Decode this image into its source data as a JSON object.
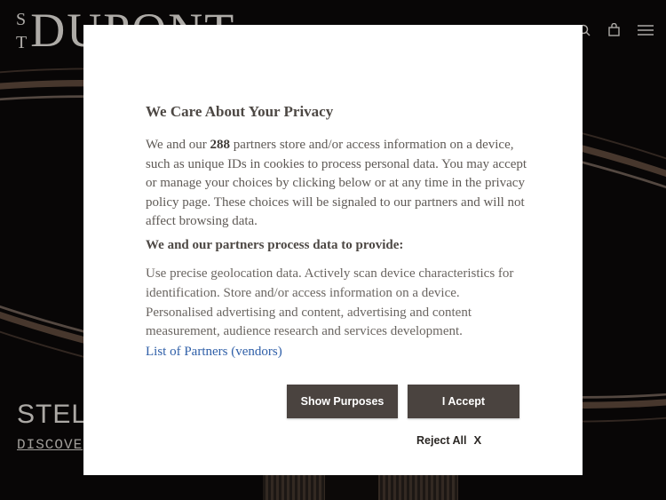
{
  "header": {
    "logo_mono_top": "S",
    "logo_mono_bottom": "T",
    "logo_word": "DUPONT",
    "icons": [
      "search-icon",
      "bag-icon",
      "menu-icon"
    ]
  },
  "hero": {
    "title": "STEL",
    "link": "DISCOVE"
  },
  "consent": {
    "title": "We Care About Your Privacy",
    "body_prefix": "We and our ",
    "partner_count": "288",
    "body_suffix": " partners store and/or access information on a device, such as unique IDs in cookies to process personal data. You may accept or manage your choices by clicking below or at any time in the privacy policy page. These choices will be signaled to our partners and will not affect browsing data.",
    "subtitle": "We and our partners process data to provide:",
    "purposes": "Use precise geolocation data. Actively scan device characteristics for identification. Store and/or access information on a device. Personalised advertising and content, advertising and content measurement, audience research and services development.",
    "partners_link": "List of Partners (vendors)",
    "show_purposes_label": "Show Purposes",
    "accept_label": "I Accept",
    "reject_label": "Reject All",
    "reject_icon": "X"
  },
  "colors": {
    "button_bg": "#4a433f",
    "link": "#2f5fa8",
    "background": "#0c0a0a"
  }
}
